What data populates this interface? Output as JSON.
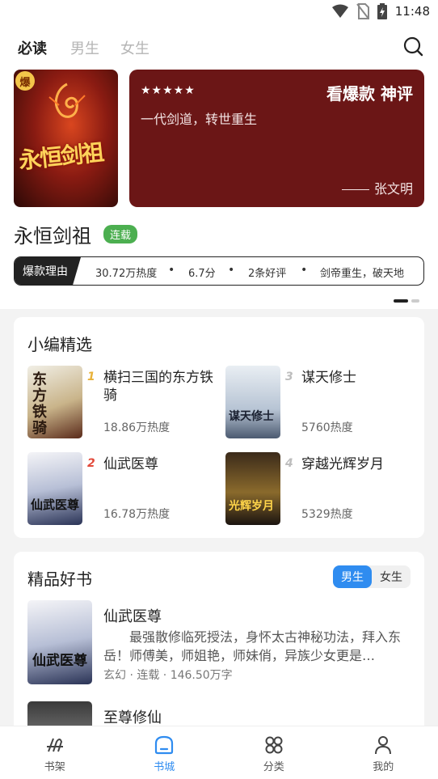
{
  "status_bar": {
    "time": "11:48",
    "icons": [
      "wifi-icon",
      "no-sim-icon",
      "battery-charging-icon"
    ]
  },
  "top_tabs": [
    {
      "label": "必读",
      "active": true
    },
    {
      "label": "男生",
      "active": false
    },
    {
      "label": "女生",
      "active": false
    }
  ],
  "search": {
    "icon": "search-icon"
  },
  "featured": {
    "cover_badge": "爆",
    "cover_title": "永恒剑祖",
    "review": {
      "stars": "★★★★★",
      "heading": "看爆款 神评",
      "quote": "一代剑道，转世重生",
      "author": "张文明"
    },
    "book_name": "永恒剑祖",
    "status": "连载",
    "reason_label": "爆款理由",
    "reasons": [
      "30.72万热度",
      "6.7分",
      "2条好评",
      "剑帝重生，破天地"
    ]
  },
  "editor_picks": {
    "title": "小编精选",
    "items": [
      {
        "rank": "1",
        "rank_color": "#e8b23a",
        "title": "横扫三国的东方铁骑",
        "heat": "18.86万热度",
        "cover_text": "东方铁骑"
      },
      {
        "rank": "3",
        "rank_color": "#bdbdbd",
        "title": "谋天修士",
        "heat": "5760热度",
        "cover_text": "谋天修士"
      },
      {
        "rank": "2",
        "rank_color": "#e24a3b",
        "title": "仙武医尊",
        "heat": "16.78万热度",
        "cover_text": "仙武医尊"
      },
      {
        "rank": "4",
        "rank_color": "#bdbdbd",
        "title": "穿越光辉岁月",
        "heat": "5329热度",
        "cover_text": "光辉岁月"
      }
    ]
  },
  "quality_books": {
    "title": "精品好书",
    "segments": [
      {
        "label": "男生",
        "active": true
      },
      {
        "label": "女生",
        "active": false
      }
    ],
    "items": [
      {
        "title": "仙武医尊",
        "desc": "最强散修临死授法，身怀太古神秘功法，拜入东岳！师傅美，师姐艳，师妹俏，异族少女更是…",
        "meta": "玄幻 · 连载 · 146.50万字",
        "cover_text": "仙武医尊"
      },
      {
        "title": "至尊修仙",
        "desc": "",
        "meta": "",
        "cover_text": ""
      }
    ]
  },
  "bottom_nav": [
    {
      "label": "书架",
      "icon": "bookshelf-icon",
      "active": false
    },
    {
      "label": "书城",
      "icon": "bookstore-icon",
      "active": true
    },
    {
      "label": "分类",
      "icon": "category-icon",
      "active": false
    },
    {
      "label": "我的",
      "icon": "profile-icon",
      "active": false
    }
  ],
  "colors": {
    "accent": "#2f8cf0",
    "review_bg": "#6b1616",
    "tag_green": "#4caf50"
  }
}
